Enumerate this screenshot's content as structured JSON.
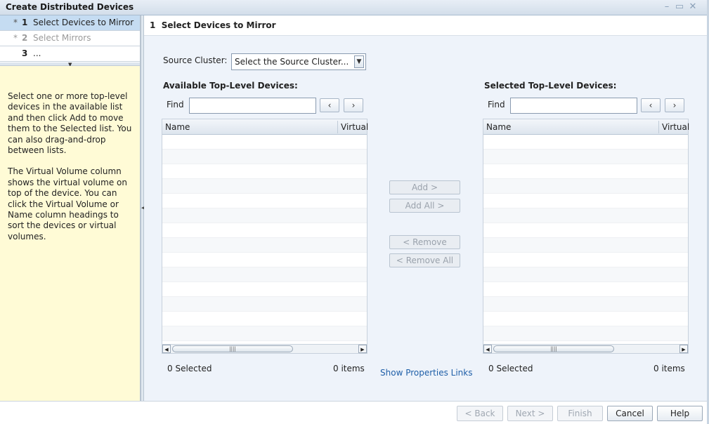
{
  "window": {
    "title": "Create Distributed Devices"
  },
  "steps": [
    {
      "star": "*",
      "num": "1",
      "label": "Select Devices to Mirror",
      "state": "active"
    },
    {
      "star": "*",
      "num": "2",
      "label": "Select Mirrors",
      "state": "disabled"
    },
    {
      "star": "",
      "num": "3",
      "label": "...",
      "state": "normal"
    }
  ],
  "help": {
    "para1": "Select one or more top-level devices in the available list and then click Add to move them to the Selected list. You can also drag-and-drop between lists.",
    "para2": "The Virtual Volume column shows the virtual volume on top of the device. You can click the Virtual Volume or Name column headings to sort the devices or virtual volumes."
  },
  "main": {
    "heading": "1  Select Devices to Mirror",
    "source_label": "Source Cluster:",
    "source_value": "Select the Source Cluster...",
    "available": {
      "title": "Available Top-Level Devices:",
      "find_label": "Find",
      "col_name": "Name",
      "col_virtual": "Virtual",
      "selected_count": "0 Selected",
      "items_count": "0 items"
    },
    "selected": {
      "title": "Selected Top-Level Devices:",
      "find_label": "Find",
      "col_name": "Name",
      "col_virtual": "Virtual",
      "selected_count": "0 Selected",
      "items_count": "0 items"
    },
    "buttons": {
      "add": "Add >",
      "add_all": "Add All >",
      "remove": "< Remove",
      "remove_all": "< Remove All"
    },
    "link": "Show Properties Links"
  },
  "footer": {
    "back": "< Back",
    "next": "Next >",
    "finish": "Finish",
    "cancel": "Cancel",
    "help": "Help"
  }
}
